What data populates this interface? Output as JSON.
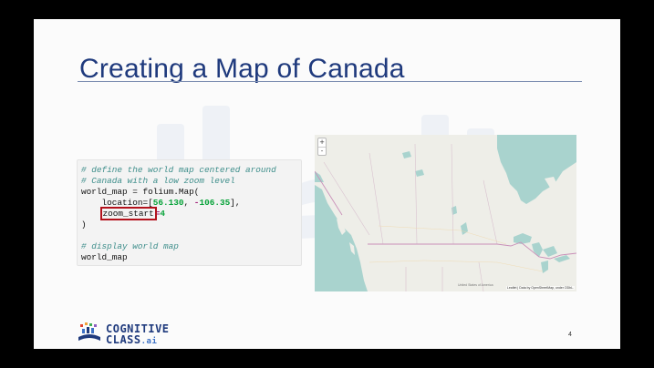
{
  "slide": {
    "title": "Creating a Map of Canada",
    "page_number": "4"
  },
  "code": {
    "line1": "# define the world map centered around",
    "line2": "# Canada with a low zoom level",
    "line3": "world_map = folium.Map(",
    "line4_prefix": "    location=[",
    "line4_lat": "56.130",
    "line4_sep": ", ",
    "line4_minus": "-",
    "line4_lon": "106.35",
    "line4_suffix": "],",
    "line5_indent": "    ",
    "line5_param": "zoom_start",
    "line5_eq": "=",
    "line5_value": "4",
    "line6": ")",
    "line8": "# display world map",
    "line9": "world_map"
  },
  "map": {
    "zoom_in": "+",
    "zoom_out": "-",
    "attribution": "Leaflet | Data by OpenStreetMap, under ODbL.",
    "label_us": "United States of America"
  },
  "logo": {
    "line1": "COGNITIVE",
    "line2": "CLASS",
    "line2_suffix": ".ai"
  },
  "colors": {
    "title": "#1f3a7d",
    "highlight_box": "#b3121c",
    "water": "#a9d3ce",
    "land": "#eeeee8",
    "border": "#c98fb8"
  }
}
